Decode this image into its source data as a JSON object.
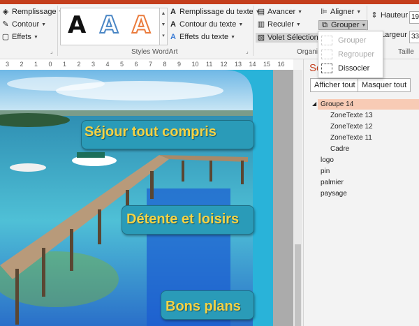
{
  "ribbon": {
    "shape_fill": "Remplissage",
    "shape_outline": "Contour",
    "shape_effects": "Effets",
    "wordart_samples": [
      "A",
      "A",
      "A"
    ],
    "wordart_group_label": "Styles WordArt",
    "text_fill": "Remplissage du texte",
    "text_outline": "Contour du texte",
    "text_effects": "Effets du texte",
    "bring_forward": "Avancer",
    "send_backward": "Reculer",
    "selection_pane": "Volet Sélection",
    "arrange_label_visible": "Organis",
    "align": "Aligner",
    "group": "Grouper",
    "height_label": "Hauteur :",
    "height_value": "19",
    "width_label": "Largeur :",
    "width_value": "33",
    "size_group_label": "Taille"
  },
  "group_menu": {
    "items": [
      {
        "label": "Grouper",
        "enabled": false
      },
      {
        "label": "Regrouper",
        "enabled": false
      },
      {
        "label": "Dissocier",
        "enabled": true
      }
    ]
  },
  "ruler": {
    "marks": [
      "3",
      "2",
      "1",
      "0",
      "1",
      "2",
      "3",
      "4",
      "5",
      "6",
      "7",
      "8",
      "9",
      "10",
      "11",
      "12",
      "13",
      "14",
      "15",
      "16"
    ]
  },
  "slide": {
    "bands": [
      "Séjour tout compris",
      "Détente et loisirs",
      "Bons plans"
    ]
  },
  "selection_pane": {
    "title_visible": "Sé",
    "show_all": "Afficher tout",
    "hide_all": "Masquer tout",
    "items": [
      {
        "label": "Groupe 14",
        "level": 0,
        "selected": true,
        "expanded": true
      },
      {
        "label": "ZoneTexte 13",
        "level": 1
      },
      {
        "label": "ZoneTexte 12",
        "level": 1
      },
      {
        "label": "ZoneTexte 11",
        "level": 1
      },
      {
        "label": "Cadre",
        "level": 1
      },
      {
        "label": "logo",
        "level": 0
      },
      {
        "label": "pin",
        "level": 0
      },
      {
        "label": "palmier",
        "level": 0
      },
      {
        "label": "paysage",
        "level": 0
      }
    ]
  },
  "colors": {
    "accent": "#c43e1c",
    "slide_bg": "#29b3d9",
    "band_text": "#f4d245",
    "selected_row": "#f8cbb5"
  }
}
